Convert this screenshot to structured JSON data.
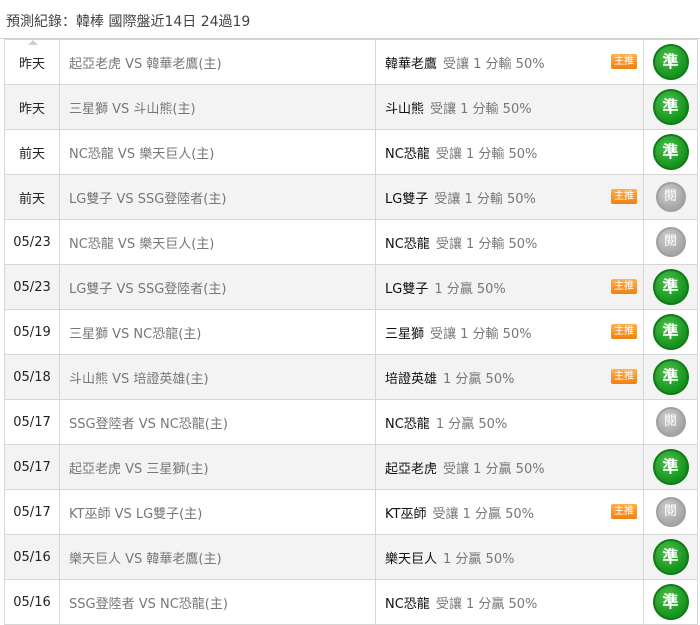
{
  "header": {
    "title": "預測紀錄：韓棒 國際盤近14日 24過19"
  },
  "rows": [
    {
      "date": "昨天",
      "match": "起亞老虎 VS 韓華老鷹(主)",
      "pick_team": "韓華老鷹",
      "pick_handicap": "受讓 1 分輸 50%",
      "badge": "主推",
      "result": "準",
      "result_type": "win"
    },
    {
      "date": "昨天",
      "match": "三星獅 VS 斗山熊(主)",
      "pick_team": "斗山熊",
      "pick_handicap": "受讓 1 分輸 50%",
      "badge": "",
      "result": "準",
      "result_type": "win"
    },
    {
      "date": "前天",
      "match": "NC恐龍 VS 樂天巨人(主)",
      "pick_team": "NC恐龍",
      "pick_handicap": "受讓 1 分輸 50%",
      "badge": "",
      "result": "準",
      "result_type": "win"
    },
    {
      "date": "前天",
      "match": "LG雙子 VS SSG登陸者(主)",
      "pick_team": "LG雙子",
      "pick_handicap": "受讓 1 分輸 50%",
      "badge": "主推",
      "result": "閱",
      "result_type": "push"
    },
    {
      "date": "05/23",
      "match": "NC恐龍 VS 樂天巨人(主)",
      "pick_team": "NC恐龍",
      "pick_handicap": "受讓 1 分輸 50%",
      "badge": "",
      "result": "閱",
      "result_type": "push"
    },
    {
      "date": "05/23",
      "match": "LG雙子 VS SSG登陸者(主)",
      "pick_team": "LG雙子",
      "pick_handicap": "1 分贏 50%",
      "badge": "主推",
      "result": "準",
      "result_type": "win"
    },
    {
      "date": "05/19",
      "match": "三星獅 VS NC恐龍(主)",
      "pick_team": "三星獅",
      "pick_handicap": "受讓 1 分輸 50%",
      "badge": "主推",
      "result": "準",
      "result_type": "win"
    },
    {
      "date": "05/18",
      "match": "斗山熊 VS 培證英雄(主)",
      "pick_team": "培證英雄",
      "pick_handicap": "1 分贏 50%",
      "badge": "主推",
      "result": "準",
      "result_type": "win"
    },
    {
      "date": "05/17",
      "match": "SSG登陸者 VS NC恐龍(主)",
      "pick_team": "NC恐龍",
      "pick_handicap": "1 分贏 50%",
      "badge": "",
      "result": "閱",
      "result_type": "push"
    },
    {
      "date": "05/17",
      "match": "起亞老虎 VS 三星獅(主)",
      "pick_team": "起亞老虎",
      "pick_handicap": "受讓 1 分贏 50%",
      "badge": "",
      "result": "準",
      "result_type": "win"
    },
    {
      "date": "05/17",
      "match": "KT巫師 VS LG雙子(主)",
      "pick_team": "KT巫師",
      "pick_handicap": "受讓 1 分贏 50%",
      "badge": "主推",
      "result": "閱",
      "result_type": "push"
    },
    {
      "date": "05/16",
      "match": "樂天巨人 VS 韓華老鷹(主)",
      "pick_team": "樂天巨人",
      "pick_handicap": "1 分贏 50%",
      "badge": "",
      "result": "準",
      "result_type": "win"
    },
    {
      "date": "05/16",
      "match": "SSG登陸者 VS NC恐龍(主)",
      "pick_team": "NC恐龍",
      "pick_handicap": "受讓 1 分贏 50%",
      "badge": "",
      "result": "準",
      "result_type": "win"
    }
  ]
}
